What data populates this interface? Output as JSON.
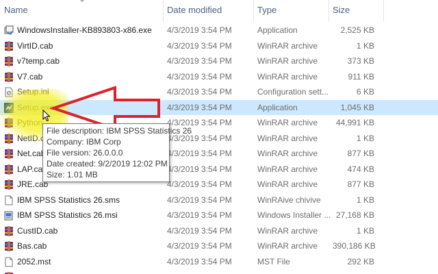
{
  "header": {
    "name": "Name",
    "date": "Date modified",
    "type": "Type",
    "size": "Size"
  },
  "files": [
    {
      "name": "WindowsInstaller-KB893803-x86.exe",
      "date": "4/3/2019 3:54 PM",
      "type": "Application",
      "size": "2,525 KB",
      "icon": "installer-icon"
    },
    {
      "name": "VirtID.cab",
      "date": "4/3/2019 3:54 PM",
      "type": "WinRAR archive",
      "size": "1 KB",
      "icon": "winrar-archive-icon"
    },
    {
      "name": "v7temp.cab",
      "date": "4/3/2019 3:54 PM",
      "type": "WinRAR archive",
      "size": "373 KB",
      "icon": "winrar-archive-icon"
    },
    {
      "name": "V7.cab",
      "date": "4/3/2019 3:54 PM",
      "type": "WinRAR archive",
      "size": "911 KB",
      "icon": "winrar-archive-icon"
    },
    {
      "name": "Setup.ini",
      "date": "4/3/2019 3:54 PM",
      "type": "Configuration sett...",
      "size": "6 KB",
      "icon": "config-file-icon"
    },
    {
      "name": "Setup.exe",
      "date": "4/3/2019 3:54 PM",
      "type": "Application",
      "size": "1,045 KB",
      "icon": "spss-setup-icon",
      "selected": true
    },
    {
      "name": "Python",
      "date": "4/3/2019 3:54 PM",
      "type": "WinRAR archive",
      "size": "44,991 KB",
      "icon": "winrar-archive-icon"
    },
    {
      "name": "NetID.ca",
      "date": "4/3/2019 3:54 PM",
      "type": "WinRAR archive",
      "size": "1 KB",
      "icon": "winrar-archive-icon"
    },
    {
      "name": "Net.cab",
      "date": "4/3/2019 3:54 PM",
      "type": "WinRAR archive",
      "size": "877 KB",
      "icon": "winrar-archive-icon"
    },
    {
      "name": "LAP.cab",
      "date": "4/3/2019 3:54 PM",
      "type": "WinRAR archive",
      "size": "474 KB",
      "icon": "winrar-archive-icon"
    },
    {
      "name": "JRE.cab",
      "date": "4/3/2019 3:54 PM",
      "type": "WinRAR archive",
      "size": "877 KB",
      "icon": "winrar-archive-icon"
    },
    {
      "name": "IBM SPSS Statistics 26.sms",
      "date": "4/3/2019 3:54 PM",
      "type": "WinRAive chivive",
      "size": "1 KB",
      "icon": "blank-file-icon"
    },
    {
      "name": "IBM SPSS Statistics 26.msi",
      "date": "4/3/2019 3:54 PM",
      "type": "Windows Installer ...",
      "size": "27,168 KB",
      "icon": "msi-package-icon"
    },
    {
      "name": "CustID.cab",
      "date": "4/3/2019 3:54 PM",
      "type": "WinRAR archive",
      "size": "1 KB",
      "icon": "winrar-archive-icon"
    },
    {
      "name": "Bas.cab",
      "date": "4/3/2019 3:54 PM",
      "type": "WinRAR archive",
      "size": "390,186 KB",
      "icon": "winrar-archive-icon"
    },
    {
      "name": "2052.mst",
      "date": "4/3/2019 3:54 PM",
      "type": "MST File",
      "size": "292 KB",
      "icon": "blank-file-icon"
    },
    {
      "name": "",
      "date": "",
      "type": "",
      "size": "",
      "icon": "winrar-archive-icon"
    }
  ],
  "tooltip": {
    "description": "File description: IBM SPSS Statistics 26",
    "company": "Company: IBM Corp",
    "version": "File version: 26.0.0.0",
    "created": "Date created: 9/2/2019 12:02 PM",
    "size": "Size: 1.01 MB"
  },
  "colors": {
    "selection": "#cce8ff",
    "arrow": "#d9232d",
    "highlight": "#f5f028",
    "header_text": "#4d6082"
  }
}
